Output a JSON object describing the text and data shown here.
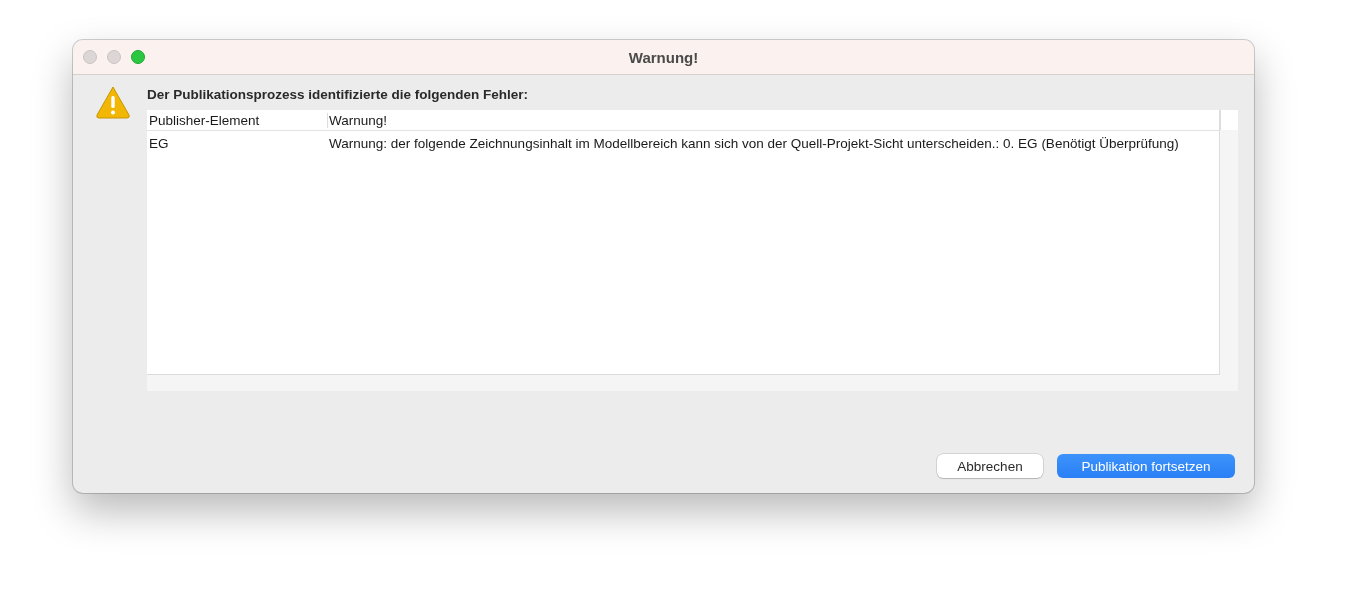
{
  "window": {
    "title": "Warnung!"
  },
  "message": "Der Publikationsprozess identifizierte die folgenden Fehler:",
  "table": {
    "columns": [
      "Publisher-Element",
      "Warnung!"
    ],
    "rows": [
      {
        "cells": [
          "EG",
          "Warnung: der folgende Zeichnungsinhalt im Modellbereich kann sich von der Quell-Projekt-Sicht unterscheiden.: 0. EG (Benötigt Überprüfung)"
        ]
      }
    ]
  },
  "buttons": [
    {
      "label": "Abbrechen",
      "kind": "secondary"
    },
    {
      "label": "Publikation fortsetzen",
      "kind": "primary"
    }
  ]
}
